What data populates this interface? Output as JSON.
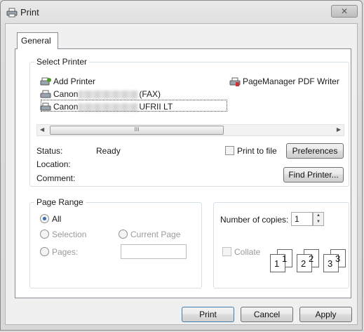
{
  "window": {
    "title": "Print",
    "close_label": "✕"
  },
  "tabs": [
    {
      "label": "General"
    }
  ],
  "select_printer": {
    "legend": "Select Printer",
    "printers": [
      {
        "name": "Add Printer"
      },
      {
        "name_prefix": "Canon",
        "name_suffix": "(FAX)"
      },
      {
        "name_prefix": "Canon",
        "name_suffix": "UFRII LT"
      },
      {
        "name": "PageManager PDF Writer"
      }
    ],
    "scroll_thumb_mark": "III"
  },
  "status": {
    "status_label": "Status:",
    "status_value": "Ready",
    "location_label": "Location:",
    "comment_label": "Comment:",
    "print_to_file_label": "Print to file",
    "preferences_button": "Preferences",
    "find_printer_button": "Find Printer..."
  },
  "page_range": {
    "legend": "Page Range",
    "all_label": "All",
    "selection_label": "Selection",
    "current_page_label": "Current Page",
    "pages_label": "Pages:",
    "pages_value": ""
  },
  "copies": {
    "number_label": "Number of copies:",
    "number_value": "1",
    "collate_label": "Collate",
    "collate_pages": [
      "1",
      "1",
      "2",
      "2",
      "3",
      "3"
    ]
  },
  "buttons": {
    "print": "Print",
    "cancel": "Cancel",
    "apply": "Apply"
  }
}
